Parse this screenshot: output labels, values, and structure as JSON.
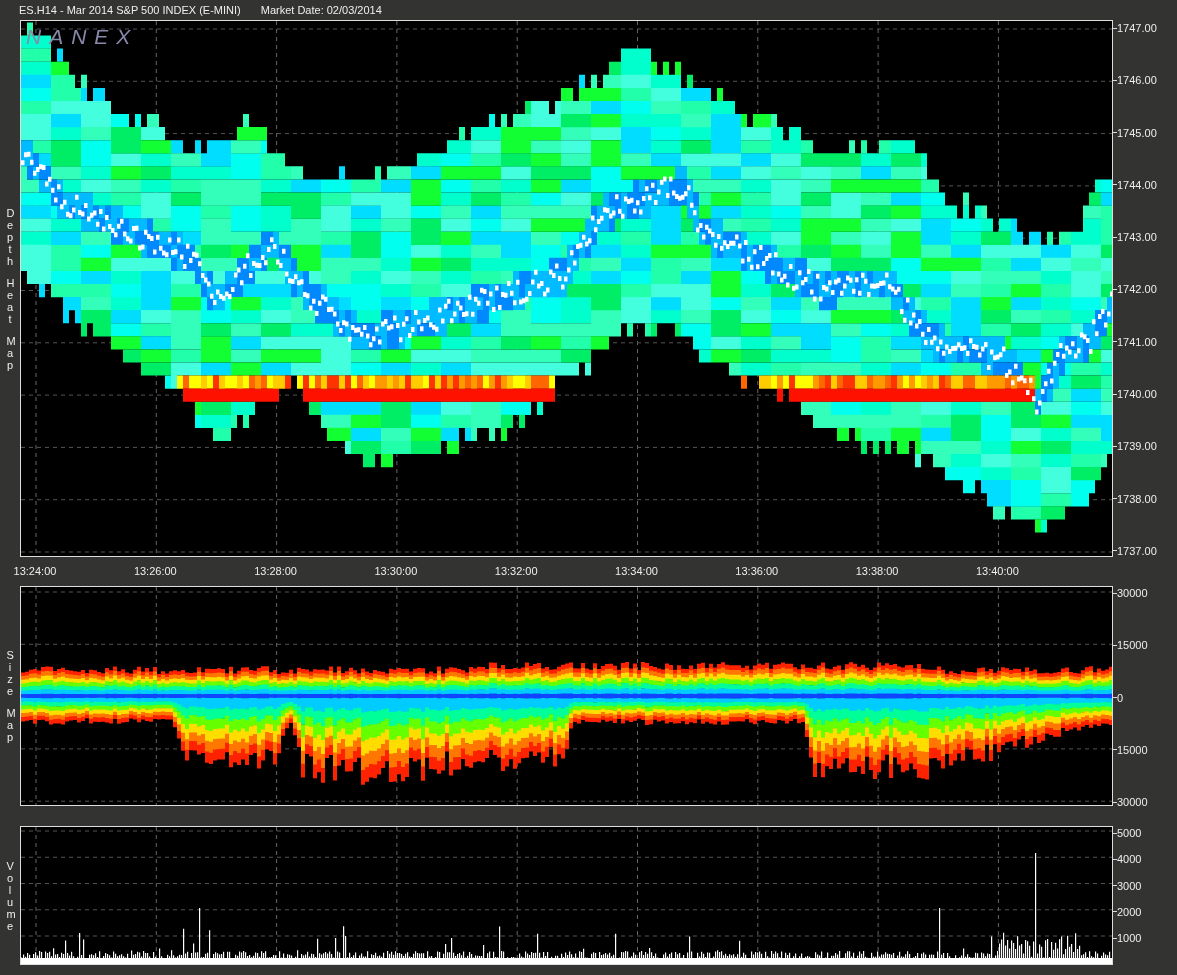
{
  "header": {
    "symbol": "ES.H14 - Mar 2014 S&P 500 INDEX (E-MINI)",
    "market_date": "Market Date: 02/03/2014"
  },
  "logo": "NANEX",
  "panels": [
    {
      "kind": "depth",
      "label": "Depth Heat Map",
      "y_ticks": [
        "1747.00",
        "1746.00",
        "1745.00",
        "1744.00",
        "1743.00",
        "1742.00",
        "1741.00",
        "1740.00",
        "1739.00",
        "1738.00",
        "1737.00"
      ]
    },
    {
      "kind": "size",
      "label": "Size Map",
      "y_ticks": [
        "30000",
        "15000",
        "0",
        "15000",
        "30000"
      ]
    },
    {
      "kind": "volume",
      "label": "Volume",
      "y_ticks": [
        "5000",
        "4000",
        "3000",
        "2000",
        "1000"
      ]
    }
  ],
  "time_axis": [
    "13:24:00",
    "13:26:00",
    "13:28:00",
    "13:30:00",
    "13:32:00",
    "13:34:00",
    "13:36:00",
    "13:38:00",
    "13:40:00"
  ]
}
